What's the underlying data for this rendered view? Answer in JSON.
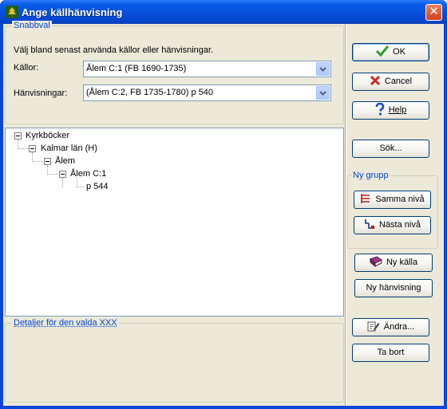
{
  "window": {
    "title": "Ange källhänvisning",
    "close_glyph": "✕"
  },
  "snabbval": {
    "legend": "Snabbval",
    "description": "Välj bland senast använda källor eller hänvisningar.",
    "kallor_label": "Källor:",
    "kallor_value": "Ålem C:1 (FB 1690-1735)",
    "hanvisningar_label": "Hänvisningar:",
    "hanvisningar_value": "(Ålem C:2, FB 1735-1780) p 540"
  },
  "tree": {
    "nodes": [
      {
        "label": "Kyrkböcker"
      },
      {
        "label": "Kalmar län (H)"
      },
      {
        "label": "Ålem"
      },
      {
        "label": "Ålem C:1"
      },
      {
        "label": "p 544"
      }
    ]
  },
  "details": {
    "legend": "Detaljer för den valda XXX"
  },
  "buttons": {
    "ok": "OK",
    "cancel": "Cancel",
    "help": "Help",
    "sok": "Sök...",
    "ny_grupp_legend": "Ny grupp",
    "samma_niva": "Samma nivå",
    "nasta_niva": "Nästa nivå",
    "ny_kalla": "Ny källa",
    "ny_hanvisning": "Ny hänvisning",
    "andra": "Ändra...",
    "ta_bort": "Ta bort"
  },
  "colors": {
    "titlebar": "#0551dd",
    "dialog_bg": "#ece9d8",
    "group_legend": "#0046d5",
    "ok_check": "#2ea02e",
    "cancel_x": "#c8281e",
    "help_q": "#1e4fbf"
  },
  "icons": {
    "app": "tree-icon",
    "ok": "checkmark-icon",
    "cancel": "x-icon",
    "help": "question-icon",
    "samma_niva": "same-level-icon",
    "nasta_niva": "next-level-icon",
    "ny_kalla": "book-icon",
    "andra": "edit-icon"
  }
}
